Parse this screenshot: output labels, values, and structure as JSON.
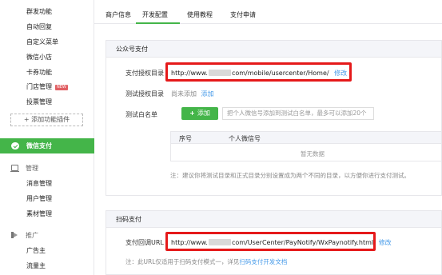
{
  "sidebar": {
    "top_items": [
      {
        "label": "群发功能"
      },
      {
        "label": "自动回复"
      },
      {
        "label": "自定义菜单"
      },
      {
        "label": "微信小店"
      },
      {
        "label": "卡券功能"
      },
      {
        "label": "门店管理",
        "badge": "NEW"
      },
      {
        "label": "投票管理"
      }
    ],
    "add_plugin": "+ 添加功能插件",
    "active_item": "微信支付",
    "manage_section": "管理",
    "manage_items": [
      {
        "label": "消息管理"
      },
      {
        "label": "用户管理"
      },
      {
        "label": "素材管理"
      }
    ],
    "promo_section": "推广",
    "promo_items": [
      {
        "label": "广告主"
      },
      {
        "label": "流量主"
      }
    ]
  },
  "tabs": [
    {
      "label": "商户信息"
    },
    {
      "label": "开发配置"
    },
    {
      "label": "使用教程"
    },
    {
      "label": "支付申请"
    }
  ],
  "mp_panel": {
    "title": "公众号支付",
    "auth_dir_label": "支付授权目录",
    "auth_dir_prefix": "http://www.",
    "auth_dir_suffix": "com/mobile/usercenter/Home/",
    "auth_dir_edit": "修改",
    "test_dir_label": "测试授权目录",
    "test_dir_value": "尚未添加",
    "test_dir_add": "添加",
    "whitelist_label": "测试白名单",
    "whitelist_add_btn": "添加",
    "whitelist_placeholder": "把个人微信号添加到测试白名单，最多可以添加20个",
    "table_headers": [
      "序号",
      "个人微信号"
    ],
    "table_empty": "暂无数据",
    "note": "注：建议你将测试目录和正式目录分别设置成为两个不同的目录，以方便你进行支付测试。"
  },
  "scan_panel": {
    "title": "扫码支付",
    "callback_label": "支付回调URL",
    "callback_prefix": "http://www.",
    "callback_suffix": "com/UserCenter/PayNotify/WxPaynotify.html",
    "callback_edit": "修改",
    "note_prefix": "注：此URL仅适用于扫码支付模式一，详见",
    "note_link": "扫码支付开发文档"
  },
  "colors": {
    "accent": "#44b549",
    "link": "#459ae9",
    "highlight_box": "#e5191a"
  }
}
